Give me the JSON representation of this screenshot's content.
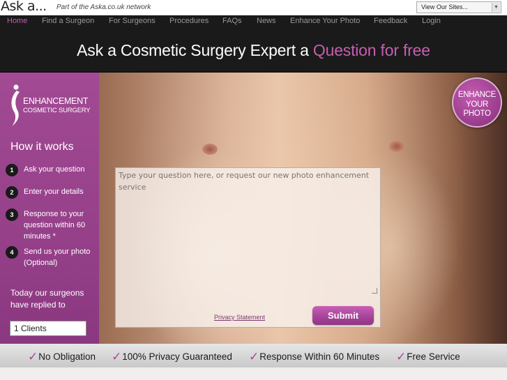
{
  "topbar": {
    "logo_text": "Ask a...",
    "network_text": "Part of the Aska.co.uk network",
    "sites_select_value": "View Our Sites..."
  },
  "nav": {
    "items": [
      {
        "label": "Home",
        "active": true
      },
      {
        "label": "Find a Surgeon",
        "active": false
      },
      {
        "label": "For Surgeons",
        "active": false
      },
      {
        "label": "Procedures",
        "active": false
      },
      {
        "label": "FAQs",
        "active": false
      },
      {
        "label": "News",
        "active": false
      },
      {
        "label": "Enhance Your Photo",
        "active": false
      },
      {
        "label": "Feedback",
        "active": false
      },
      {
        "label": "Login",
        "active": false
      }
    ]
  },
  "banner": {
    "text_main": "Ask a Cosmetic Surgery Expert a",
    "text_highlight": "Question for free"
  },
  "sidebar": {
    "brand_line1": "ENHANCEMENT",
    "brand_line2": "COSMETIC SURGERY",
    "how_title": "How it works",
    "steps": [
      {
        "num": "1",
        "text": "Ask your question"
      },
      {
        "num": "2",
        "text": "Enter your details"
      },
      {
        "num": "3",
        "text": "Response to your question within 60 minutes *"
      },
      {
        "num": "4",
        "text": "Send us your photo (Optional)"
      }
    ],
    "replied_text": "Today our surgeons have replied to",
    "clients_value": "1 Clients"
  },
  "form": {
    "placeholder": "Type your question here, or request our new photo enhancement service",
    "privacy_label": "Privacy Statement",
    "submit_label": "Submit"
  },
  "badge": {
    "line1": "ENHANCE",
    "line2": "YOUR",
    "line3": "PHOTO"
  },
  "benefits": [
    "No Obligation",
    "100% Privacy Guaranteed",
    "Response Within 60 Minutes",
    "Free Service"
  ],
  "colors": {
    "accent": "#a2459a",
    "nav_active": "#c45cae",
    "dark_bar": "#1a1a1a"
  }
}
